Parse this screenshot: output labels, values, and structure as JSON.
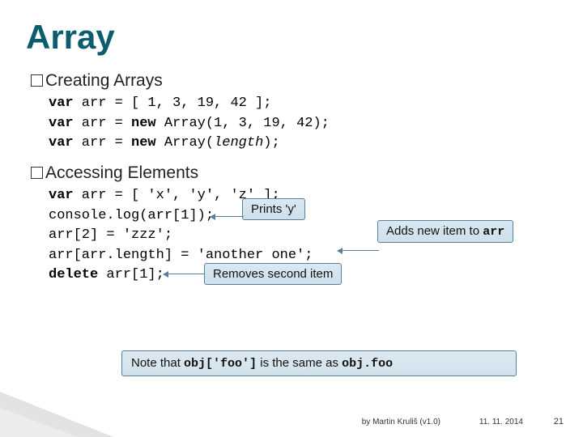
{
  "title": "Array",
  "sections": {
    "creating": {
      "bullet_lead": "Creating",
      "bullet_rest": " Arrays"
    },
    "accessing": {
      "bullet_lead": "Accessing",
      "bullet_rest": " Elements"
    }
  },
  "code1": {
    "l1a": "var",
    "l1b": " arr = [ 1, 3, 19, 42 ];",
    "l2a": "var",
    "l2b": " arr = ",
    "l2c": "new",
    "l2d": " Array(1, 3, 19, 42);",
    "l3a": "var",
    "l3b": " arr = ",
    "l3c": "new",
    "l3d": " Array(",
    "l3e": "length",
    "l3f": ");"
  },
  "code2": {
    "l1a": "var",
    "l1b": " arr = [ 'x', 'y', 'z' ];",
    "l2": "console.log(arr[1]);",
    "l3": "arr[2] = 'zzz';",
    "l4": "arr[arr.length] = 'another one';",
    "l5a": "delete",
    "l5b": " arr[1];"
  },
  "callouts": {
    "printsY": "Prints 'y'",
    "addsNew_pre": "Adds new item to ",
    "addsNew_mono": "arr",
    "removes": "Removes second item"
  },
  "note": {
    "pre": "Note that ",
    "m1": "obj['foo']",
    "mid": " is the same as ",
    "m2": "obj.foo"
  },
  "footer": {
    "author": "by Martin Kruliš (v1.0)",
    "date": "11. 11. 2014",
    "page": "21"
  }
}
